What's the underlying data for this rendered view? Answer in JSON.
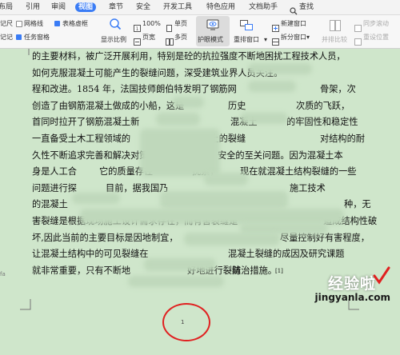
{
  "menu": {
    "items": [
      "布局",
      "引用",
      "审阅",
      "视图",
      "章节",
      "安全",
      "开发工具",
      "特色应用",
      "文档助手"
    ],
    "active_index": 3,
    "search_label": "查找"
  },
  "ribbon": {
    "col1": {
      "item1": "记尺",
      "item2": "记记"
    },
    "col2": {
      "gridlines": "网格线",
      "table_borders": "表格虚框",
      "task_pane": "任务窗格"
    },
    "zoom_label": "显示比例",
    "zoom_value": "100%",
    "page_width_label": "页宽",
    "single_page_label": "单页",
    "multi_page_label": "多页",
    "eye_mode_label": "护眼模式",
    "rearrange_label": "重排窗口",
    "new_window_label": "新建窗口",
    "split_window_label": "拆分窗口",
    "side_by_side_label": "并排比较",
    "sync_scroll_label": "同步滚动",
    "reset_position_label": "重设位置",
    "accent_color": "#3a7cf5"
  },
  "document": {
    "lines": [
      "的主要材料，被广泛开展利用，特别是砼的抗拉强度不断地困扰工程技术人员，",
      "如何克服混凝土可能产生的裂缝问题，深受建筑业界人员关注。",
      "程和改进。1854 年，法国技师朗伯特发明了钢筋网",
      "创造了由钢筋混凝土做成的小船，这是",
      "首同时拉开了钢筋混凝土新",
      "一直备受土木工程领域的",
      "久性不断追求完善和解决对策，这是涉及",
      "身是人工合",
      "问题进行探",
      "的混凝土",
      "害裂缝是根据现场施工设计需求存在，而有害裂缝是",
      "坏,因此当前的主要目标是因地制宜，",
      "让混凝土结构中的可见裂缝在",
      "就非常重要，只有不断地"
    ],
    "line_tails": [
      "",
      "",
      "",
      "",
      "",
      "",
      "",
      "",
      "",
      "",
      "",
      "",
      "",
      "防治措施。"
    ],
    "right_fragments": [
      "",
      "",
      "骨架，次",
      "次质的飞跃，",
      "的牢固性和稳定性",
      "对结构的耐",
      "安全的至关问题。因为混凝土本",
      "现在就混凝土结构裂缝的一些",
      "施工技术",
      "种，无",
      "造成结构性破",
      "尽量控制好有害程度，",
      "混凝土裂缝的成因及研究课题",
      ""
    ],
    "mid_fragments": [
      "",
      "",
      "",
      "历史",
      "混凝土",
      "",
      "",
      "扰素，",
      "目前，据我国乃",
      "",
      "",
      "",
      "",
      "好地进行裂缝"
    ],
    "extra_mid": [
      "",
      "",
      "",
      "",
      "混凝土",
      "混凝土的裂缝",
      "",
      "它的质量存在",
      "",
      "",
      "",
      "",
      "",
      ""
    ],
    "citation": "[1]",
    "page_number": "1",
    "left_margin_mark": "fa"
  },
  "watermark": {
    "text": "经验啦",
    "url": "jingyanla.com",
    "check_color": "#e02020"
  },
  "annotation_color": "#e02020"
}
